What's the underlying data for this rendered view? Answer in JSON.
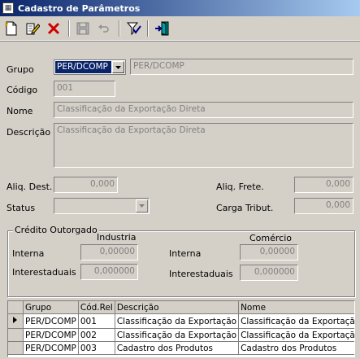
{
  "window": {
    "title": "Cadastro de Parâmetros"
  },
  "toolbar": {
    "buttons": [
      {
        "name": "new-icon"
      },
      {
        "name": "edit-icon"
      },
      {
        "name": "delete-icon"
      },
      {
        "name": "save-icon"
      },
      {
        "name": "undo-icon"
      },
      {
        "name": "filter-icon"
      },
      {
        "name": "exit-icon"
      }
    ]
  },
  "form": {
    "grupo_label": "Grupo",
    "grupo_value": "PER/DCOMP",
    "grupo_desc": "PER/DCOMP",
    "codigo_label": "Código",
    "codigo_value": "001",
    "nome_label": "Nome",
    "nome_value": "Classificação da Exportação Direta",
    "descricao_label": "Descrição",
    "descricao_value": "Classificação da Exportação Direta",
    "aliq_dest_label": "Aliq. Dest.",
    "aliq_dest_value": "0,000",
    "aliq_frete_label": "Aliq. Frete.",
    "aliq_frete_value": "0,000",
    "status_label": "Status",
    "status_value": "",
    "carga_label": "Carga Tribut.",
    "carga_value": "0,000"
  },
  "credito": {
    "legend": "Crédito Outorgado",
    "industria_header": "Industria",
    "comercio_header": "Comércio",
    "interna_label": "Interna",
    "interestaduais_label": "Interestaduais",
    "industria_interna": "0,00000",
    "industria_interestaduais": "0,000000",
    "comercio_interna": "0,00000",
    "comercio_interestaduais": "0,000000"
  },
  "grid": {
    "headers": [
      "Grupo",
      "Cód.Rel",
      "Descrição",
      "Nome"
    ],
    "rows": [
      [
        "PER/DCOMP",
        "001",
        "Classificação da Exportação",
        "Classificação da Exportação"
      ],
      [
        "PER/DCOMP",
        "002",
        "Classificação da Exportação",
        "Classificação da Exportação"
      ],
      [
        "PER/DCOMP",
        "003",
        "Cadastro dos Produtos",
        "Cadastro dos Produtos"
      ]
    ]
  }
}
